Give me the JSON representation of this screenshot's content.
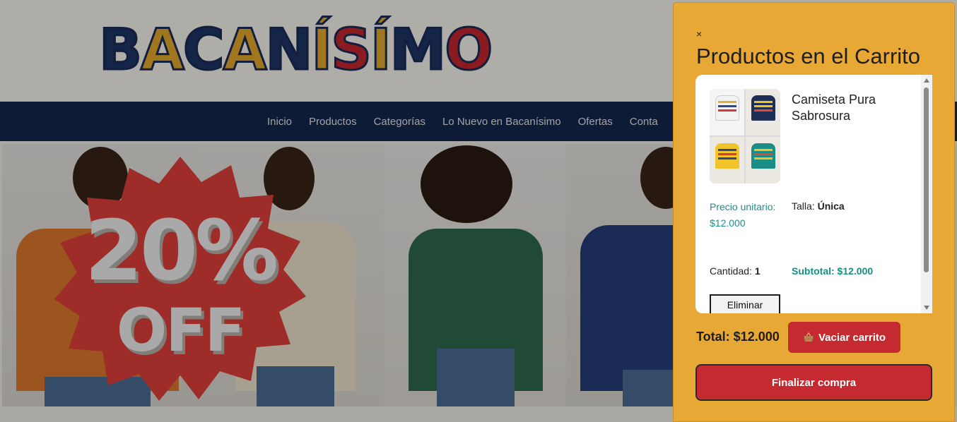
{
  "site": {
    "logo_letters": [
      "B",
      "A",
      "C",
      "A",
      "N",
      "Í",
      "S",
      "Í",
      "M",
      "O"
    ],
    "nav": [
      "Inicio",
      "Productos",
      "Categorías",
      "Lo Nuevo en Bacanísimo",
      "Ofertas",
      "Conta"
    ],
    "promo": {
      "percent": "20%",
      "label": "OFF"
    }
  },
  "cart": {
    "close_label": "×",
    "title": "Productos en el Carrito",
    "items": [
      {
        "name": "Camiseta Pura Sabrosura",
        "price_label": "Precio unitario:",
        "price": "$12.000",
        "size_label": "Talla:",
        "size": "Única",
        "qty_label": "Cantidad:",
        "qty": "1",
        "subtotal_label": "Subtotal:",
        "subtotal": "$12.000",
        "remove_label": "Eliminar"
      }
    ],
    "total_label": "Total:",
    "total": "$12.000",
    "empty_label": "Vaciar carrito",
    "checkout_label": "Finalizar compra"
  },
  "colors": {
    "cart_bg": "#e7a836",
    "nav_bg": "#14274e",
    "button_red": "#c42a2f",
    "price_teal": "#1d8f88"
  },
  "icons": [
    "close-icon",
    "basket-icon",
    "scroll-up-icon",
    "scroll-down-icon"
  ]
}
